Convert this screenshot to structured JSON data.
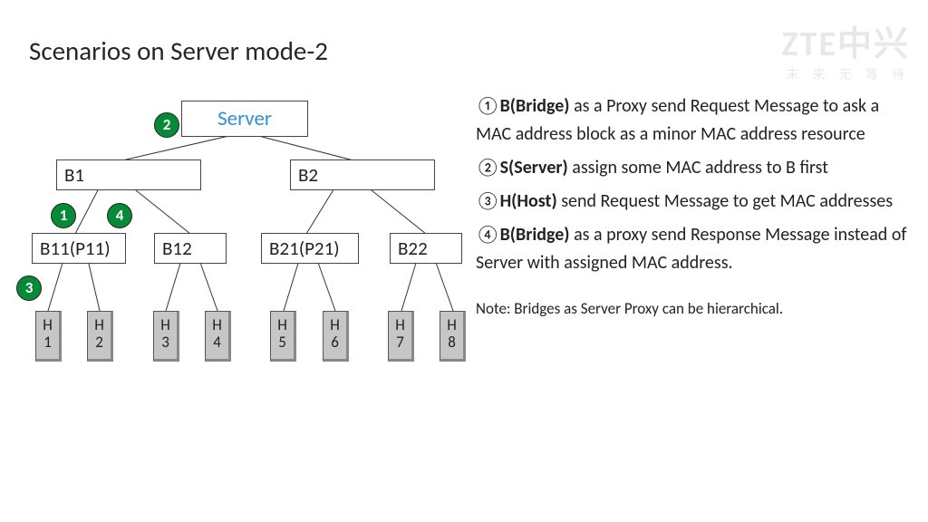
{
  "title": "Scenarios on Server mode-2",
  "logo": {
    "main": "ZTE中兴",
    "sub": "未 来 无 等 待"
  },
  "nodes": {
    "server": "Server",
    "b1": "B1",
    "b2": "B2",
    "b11": "B11(P11)",
    "b12": "B12",
    "b21": "B21(P21)",
    "b22": "B22"
  },
  "hosts": [
    "H1",
    "H2",
    "H3",
    "H4",
    "H5",
    "H6",
    "H7",
    "H8"
  ],
  "badges": {
    "b1": "1",
    "b2": "2",
    "b3": "3",
    "b4": "4"
  },
  "steps": [
    {
      "num": "①",
      "bold": "B(Bridge)",
      "text": " as a Proxy send Request Message to ask a MAC address block as a minor MAC address resource"
    },
    {
      "num": "②",
      "bold": "S(Server)",
      "text": " assign some MAC address to B first"
    },
    {
      "num": "③",
      "bold": "H(Host)",
      "text": " send Request Message to get MAC addresses"
    },
    {
      "num": "④",
      "bold": "B(Bridge)",
      "text": " as a proxy send Response Message instead of Server with assigned MAC address."
    }
  ],
  "note": "Note: Bridges as Server Proxy can be hierarchical."
}
